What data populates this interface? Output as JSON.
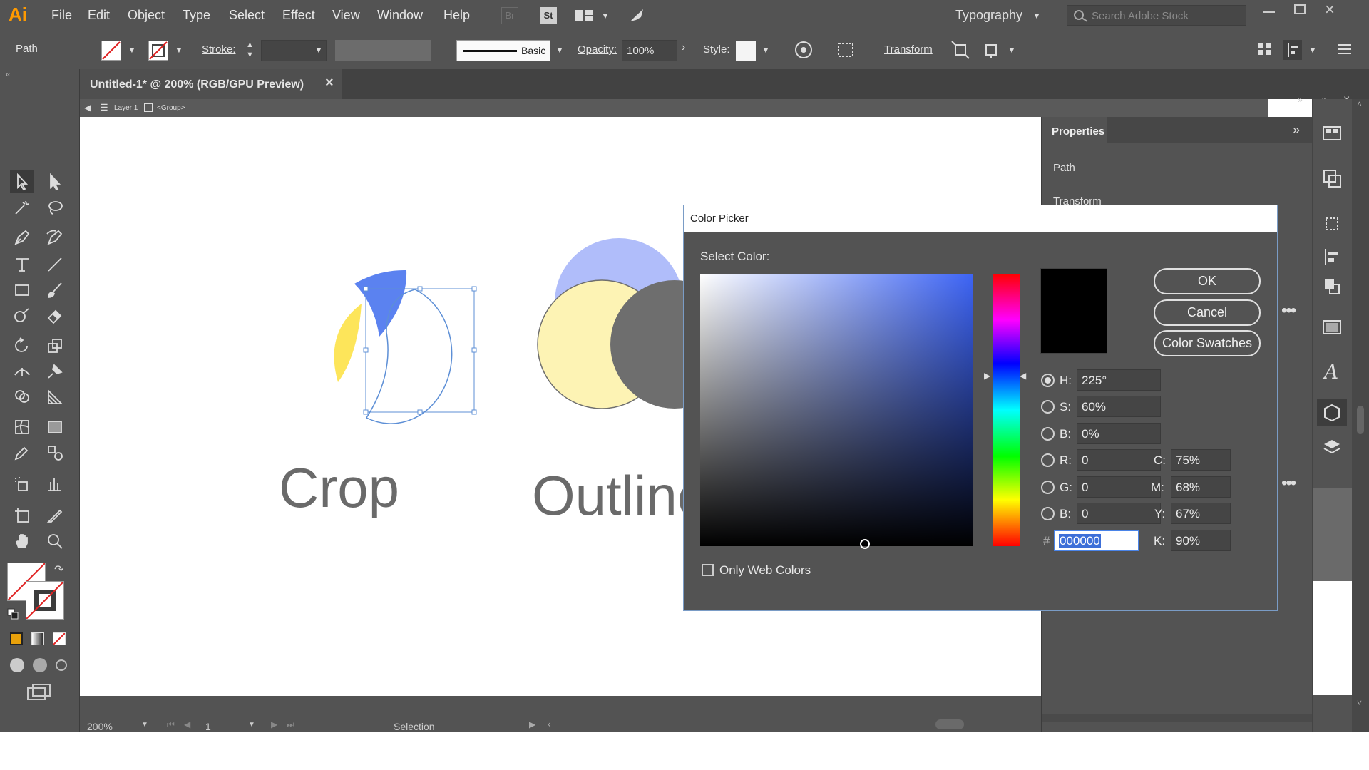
{
  "app": {
    "logo": "Ai"
  },
  "menu": [
    "File",
    "Edit",
    "Object",
    "Type",
    "Select",
    "Effect",
    "View",
    "Window",
    "Help"
  ],
  "top_right": {
    "workspace": "Typography",
    "search_placeholder": "Search Adobe Stock"
  },
  "control": {
    "selection_type": "Path",
    "stroke_label": "Stroke:",
    "brush_label": "Basic",
    "opacity_label": "Opacity:",
    "opacity_value": "100%",
    "style_label": "Style:",
    "transform_label": "Transform"
  },
  "document": {
    "tab_title": "Untitled-1* @ 200% (RGB/GPU Preview)",
    "breadcrumb_layer": "Layer 1",
    "breadcrumb_group": "<Group>"
  },
  "canvas": {
    "text_crop": "Crop",
    "text_outline": "Outline",
    "colors": {
      "blue": "#5b82f0",
      "yellow": "#fde55a",
      "light_blue": "#b0bdfa",
      "light_yellow": "#fdf3b4",
      "gray": "#6e6e6e"
    }
  },
  "properties": {
    "title": "Properties",
    "path_label": "Path",
    "transform_label": "Transform"
  },
  "status": {
    "zoom": "200%",
    "artboard": "1",
    "tool": "Selection"
  },
  "color_picker": {
    "title": "Color Picker",
    "select_label": "Select Color:",
    "ok": "OK",
    "cancel": "Cancel",
    "swatches": "Color Swatches",
    "only_web": "Only Web Colors",
    "h_label": "H:",
    "h": "225°",
    "s_label": "S:",
    "s": "60%",
    "b_label": "B:",
    "b": "0%",
    "r_label": "R:",
    "r": "0",
    "g_label": "G:",
    "g": "0",
    "bb_label": "B:",
    "bb": "0",
    "hash_label": "#",
    "hex": "000000",
    "c_label": "C:",
    "c": "75%",
    "m_label": "M:",
    "m": "68%",
    "y_label": "Y:",
    "y": "67%",
    "k_label": "K:",
    "k": "90%",
    "current_color": "#000000",
    "hue_color": "#3d64f5"
  }
}
